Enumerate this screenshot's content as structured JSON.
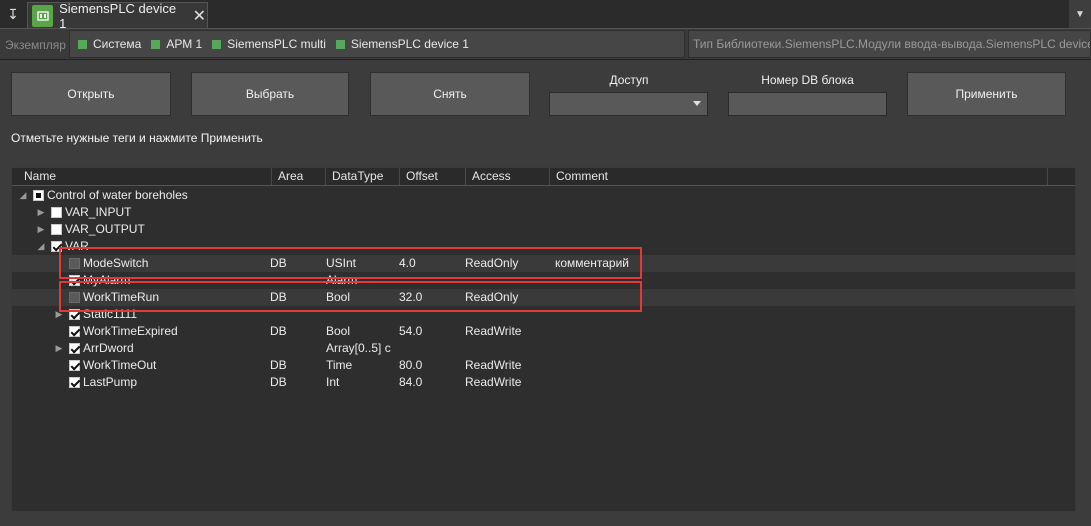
{
  "tab": {
    "title": "SiemensPLC device 1",
    "icon": "plc-device-icon"
  },
  "breadcrumb": {
    "label": "Экземпляр",
    "items": [
      "Система",
      "АРМ 1",
      "SiemensPLC multi",
      "SiemensPLC device 1"
    ],
    "library_type": "Тип Библиотеки.SiemensPLC.Модули ввода-вывода.SiemensPLC device"
  },
  "toolbar": {
    "open_label": "Открыть",
    "select_label": "Выбрать",
    "unselect_label": "Снять",
    "access_label": "Доступ",
    "access_value": "",
    "db_number_label": "Номер DB блока",
    "db_number_value": "",
    "apply_label": "Применить"
  },
  "hint": "Отметьте нужные теги и нажмите Применить",
  "table": {
    "columns": [
      "Name",
      "Area",
      "DataType",
      "Offset",
      "Access",
      "Comment"
    ],
    "rows": [
      {
        "name": "Control of water boreholes",
        "area": "",
        "type": "",
        "offset": "",
        "access": "",
        "comment": "",
        "check": "partial",
        "expand": "expanded"
      },
      {
        "name": "VAR_INPUT",
        "area": "",
        "type": "",
        "offset": "",
        "access": "",
        "comment": "",
        "check": "unchecked",
        "expand": "collapsed"
      },
      {
        "name": "VAR_OUTPUT",
        "area": "",
        "type": "",
        "offset": "",
        "access": "",
        "comment": "",
        "check": "unchecked",
        "expand": "collapsed"
      },
      {
        "name": "VAR",
        "area": "",
        "type": "",
        "offset": "",
        "access": "",
        "comment": "",
        "check": "checked",
        "expand": "expanded"
      },
      {
        "name": "ModeSwitch",
        "area": "DB",
        "type": "USInt",
        "offset": "4.0",
        "access": "ReadOnly",
        "comment": "комментарий",
        "check": "disabled",
        "expand": ""
      },
      {
        "name": "MyAlarm",
        "area": "",
        "type": "Alarm",
        "offset": "",
        "access": "",
        "comment": "",
        "check": "checked",
        "expand": ""
      },
      {
        "name": "WorkTimeRun",
        "area": "DB",
        "type": "Bool",
        "offset": "32.0",
        "access": "ReadOnly",
        "comment": "",
        "check": "disabled",
        "expand": ""
      },
      {
        "name": "Static1111",
        "area": "",
        "type": "",
        "offset": "",
        "access": "",
        "comment": "",
        "check": "checked",
        "expand": "collapsed"
      },
      {
        "name": "WorkTimeExpired",
        "area": "DB",
        "type": "Bool",
        "offset": "54.0",
        "access": "ReadWrite",
        "comment": "",
        "check": "checked",
        "expand": ""
      },
      {
        "name": "ArrDword",
        "area": "",
        "type": "Array[0..5] c",
        "offset": "",
        "access": "",
        "comment": "",
        "check": "checked",
        "expand": "collapsed"
      },
      {
        "name": "WorkTimeOut",
        "area": "DB",
        "type": "Time",
        "offset": "80.0",
        "access": "ReadWrite",
        "comment": "",
        "check": "checked",
        "expand": ""
      },
      {
        "name": "LastPump",
        "area": "DB",
        "type": "Int",
        "offset": "84.0",
        "access": "ReadWrite",
        "comment": "",
        "check": "checked",
        "expand": ""
      }
    ]
  },
  "colors": {
    "accent_green": "#58a85a",
    "highlight_red": "#e23a3a"
  }
}
